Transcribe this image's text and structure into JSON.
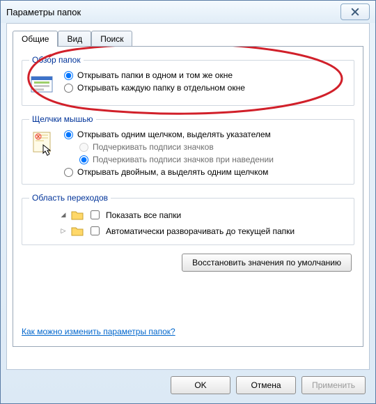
{
  "window": {
    "title": "Параметры папок"
  },
  "tabs": {
    "general": "Общие",
    "view": "Вид",
    "search": "Поиск"
  },
  "group_browse": {
    "legend": "Обзор папок",
    "opt_same_window": "Открывать папки в одном и том же окне",
    "opt_new_window": "Открывать каждую папку в отдельном окне"
  },
  "group_click": {
    "legend": "Щелчки мышью",
    "opt_single": "Открывать одним щелчком, выделять указателем",
    "opt_single_underline_always": "Подчеркивать подписи значков",
    "opt_single_underline_hover": "Подчеркивать подписи значков при наведении",
    "opt_double": "Открывать двойным, а выделять одним щелчком"
  },
  "group_nav": {
    "legend": "Область переходов",
    "chk_show_all": "Показать все папки",
    "chk_auto_expand": "Автоматически разворачивать до текущей папки"
  },
  "buttons": {
    "restore": "Восстановить значения по умолчанию",
    "ok": "OK",
    "cancel": "Отмена",
    "apply": "Применить"
  },
  "help_link": "Как можно изменить параметры папок?"
}
